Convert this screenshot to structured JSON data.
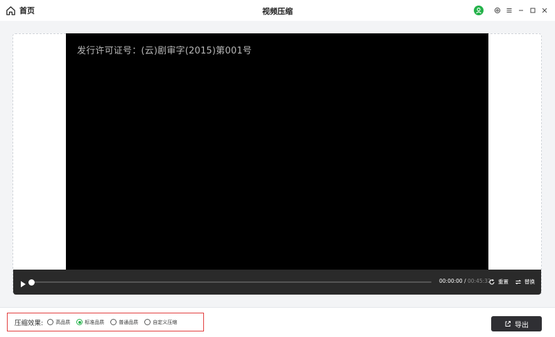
{
  "titlebar": {
    "home_label": "首页",
    "title": "视频压缩",
    "icons": [
      "home-icon",
      "user-avatar-icon",
      "settings-icon",
      "menu-icon",
      "minimize-icon",
      "maximize-icon",
      "close-icon"
    ]
  },
  "video": {
    "watermark_text": "发行许可证号：(云)剧审字(2015)第001号"
  },
  "player": {
    "current_time": "00:00:00",
    "separator": " / ",
    "total_time": "00:45:32",
    "progress_fraction": 0.0,
    "reset_label": "重置",
    "replace_label": "替换"
  },
  "compression": {
    "label": "压缩效果:",
    "options": [
      {
        "label": "高品质",
        "checked": false
      },
      {
        "label": "标准品质",
        "checked": true
      },
      {
        "label": "普通品质",
        "checked": false
      },
      {
        "label": "自定义压缩",
        "checked": false
      }
    ]
  },
  "export": {
    "label": "导出"
  },
  "colors": {
    "accent": "#24b24a",
    "highlight_border": "#e23b3b",
    "export_button": "#2f2f33",
    "control_bar": "#2a2a2a"
  }
}
